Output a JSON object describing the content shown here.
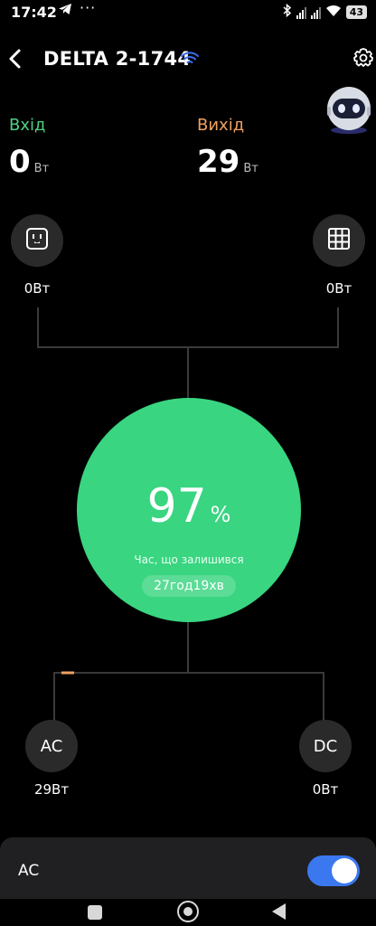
{
  "status_bar": {
    "time": "17:42",
    "battery": "43",
    "dots": "···"
  },
  "header": {
    "title": "DELTA 2-1744"
  },
  "stats": {
    "input": {
      "label": "Вхід",
      "value": "0",
      "unit": "Вт"
    },
    "output": {
      "label": "Вихід",
      "value": "29",
      "unit": "Вт"
    }
  },
  "top_ports": {
    "left": {
      "icon": "outlet-icon",
      "power": "0Вт"
    },
    "right": {
      "icon": "solar-panel-icon",
      "power": "0Вт"
    }
  },
  "battery": {
    "percent": "97",
    "percent_symbol": "%",
    "remaining_label": "Час, що залишився",
    "remaining_time": "27год19хв",
    "color": "#39d581"
  },
  "bottom_ports": {
    "ac": {
      "label": "AC",
      "power": "29Вт"
    },
    "dc": {
      "label": "DC",
      "power": "0Вт"
    }
  },
  "ac_panel": {
    "label": "AC",
    "toggle_on": true,
    "toggle_color": "#3b78f0"
  },
  "colors": {
    "input_label": "#4ed084",
    "output_label": "#f0a060",
    "flow_accent": "#f0a060"
  }
}
